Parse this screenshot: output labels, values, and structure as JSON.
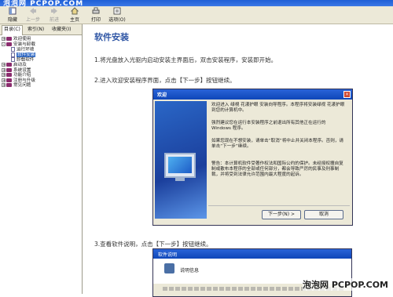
{
  "window": {
    "title": "泡泡网 PCPOP.COM"
  },
  "toolbar": {
    "buttons": [
      {
        "label": "隐藏",
        "icon": "hide-icon",
        "enabled": true
      },
      {
        "label": "上一步",
        "icon": "back-icon",
        "enabled": false
      },
      {
        "label": "前进",
        "icon": "forward-icon",
        "enabled": false
      },
      {
        "label": "主页",
        "icon": "home-icon",
        "enabled": true
      },
      {
        "label": "打印",
        "icon": "print-icon",
        "enabled": true
      },
      {
        "label": "选项(O)",
        "icon": "options-icon",
        "enabled": true
      }
    ]
  },
  "nav": {
    "tabs": [
      "目录(C)",
      "索引(N)",
      "收藏夹(I)"
    ],
    "tree": [
      {
        "label": "欢迎使用",
        "level": 0,
        "type": "book",
        "expander": "+"
      },
      {
        "label": "安装与卸载",
        "level": 0,
        "type": "book-open",
        "expander": "-"
      },
      {
        "label": "运行环境",
        "level": 1,
        "type": "page"
      },
      {
        "label": "软件安装",
        "level": 1,
        "type": "page",
        "selected": true
      },
      {
        "label": "卸载软件",
        "level": 1,
        "type": "page"
      },
      {
        "label": "启动及",
        "level": 0,
        "type": "book",
        "expander": "+"
      },
      {
        "label": "系统设置",
        "level": 0,
        "type": "book",
        "expander": "+"
      },
      {
        "label": "功能介绍",
        "level": 0,
        "type": "book",
        "expander": "+"
      },
      {
        "label": "注册与升级",
        "level": 0,
        "type": "book",
        "expander": "+"
      },
      {
        "label": "常见问题",
        "level": 0,
        "type": "book",
        "expander": "+"
      }
    ]
  },
  "content": {
    "title": "软件安装",
    "step1": "1.将光盘放入光驱内启动安装主界面后，双击安装程序，安装即开始。",
    "step2": "2.进入欢迎安装程序界面，点击【下一步】按钮继续。",
    "step3": "3.查看软件说明，点击【下一步】按钮继续。"
  },
  "installer": {
    "title": "欢迎",
    "para1": "欢迎进入 绿視 花漾护眼 安装向导程序。本程序将安装绿视 花漾护眼 到您的计算机中。",
    "para2": "强烈建议您在运行本安装程序之前退出所有其他正在运行的 Windows 程序。",
    "para3": "如果您现在不想安装，请单击“取消”将中止并关闭本程序。否则，请单击“下一步”继续。",
    "para4": "警告：本计算机软件受著作权法和国际公约的保护。未经授权擅自复制或散布本程序的全部或任何部分，都会导致严厉的民事及刑事制裁，并将受到法律允许范围内最大程度的起诉。",
    "next": "下一步(N) >",
    "cancel": "取消"
  },
  "readme": {
    "title": "软件说明",
    "heading": "说明信息"
  },
  "watermark": "泡泡网 PCPOP.COM"
}
